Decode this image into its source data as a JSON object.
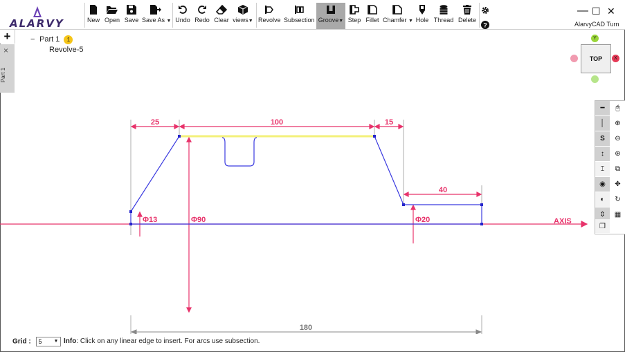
{
  "app": {
    "brand": "ALARVY",
    "name": "AlarvyCAD Turn"
  },
  "toolbar": {
    "new": "New",
    "open": "Open",
    "save": "Save",
    "save_as": "Save As",
    "undo": "Undo",
    "redo": "Redo",
    "clear": "Clear",
    "views": "views",
    "revolve": "Revolve",
    "subsection": "Subsection",
    "groove": "Groove",
    "step": "Step",
    "fillet": "Fillet",
    "chamfer": "Chamfer",
    "hole": "Hole",
    "thread": "Thread",
    "delete": "Delete"
  },
  "sidebar": {
    "add": "+",
    "close": "×",
    "tab_label": "Part 1"
  },
  "tree": {
    "part": "Part 1",
    "badge": "1",
    "child": "Revolve-5"
  },
  "view_cube": {
    "face": "TOP",
    "y_label": "Y",
    "x_label": "X"
  },
  "dimensions": {
    "d25": "25",
    "d100": "100",
    "d15": "15",
    "d40": "40",
    "phi13": "Φ13",
    "phi90": "Φ90",
    "phi20": "Φ20",
    "axis": "AXIS",
    "d180": "180"
  },
  "footer": {
    "grid_label": "Grid :",
    "grid_value": "5",
    "info_label": "Info",
    "info_text": ": Click on any linear edge to insert. For arcs use subsection."
  },
  "colors": {
    "dimension": "#e8336b",
    "profile": "#3a3ae0",
    "highlight": "#f3f07a",
    "active_tool": "#a9a9a9",
    "badge": "#f5c518"
  },
  "icons": {
    "right_toolbar": [
      "minus-icon",
      "mouse-icon",
      "line-icon",
      "zoom-in-icon",
      "s-icon",
      "zoom-out-icon",
      "vertical-arrows-icon",
      "zoom-fit-icon",
      "dimension-icon",
      "zoom-window-icon",
      "eye-icon",
      "pan-icon",
      "contrast-icon",
      "rotate-icon",
      "sort-icon",
      "grid-icon",
      "layers-icon"
    ]
  }
}
